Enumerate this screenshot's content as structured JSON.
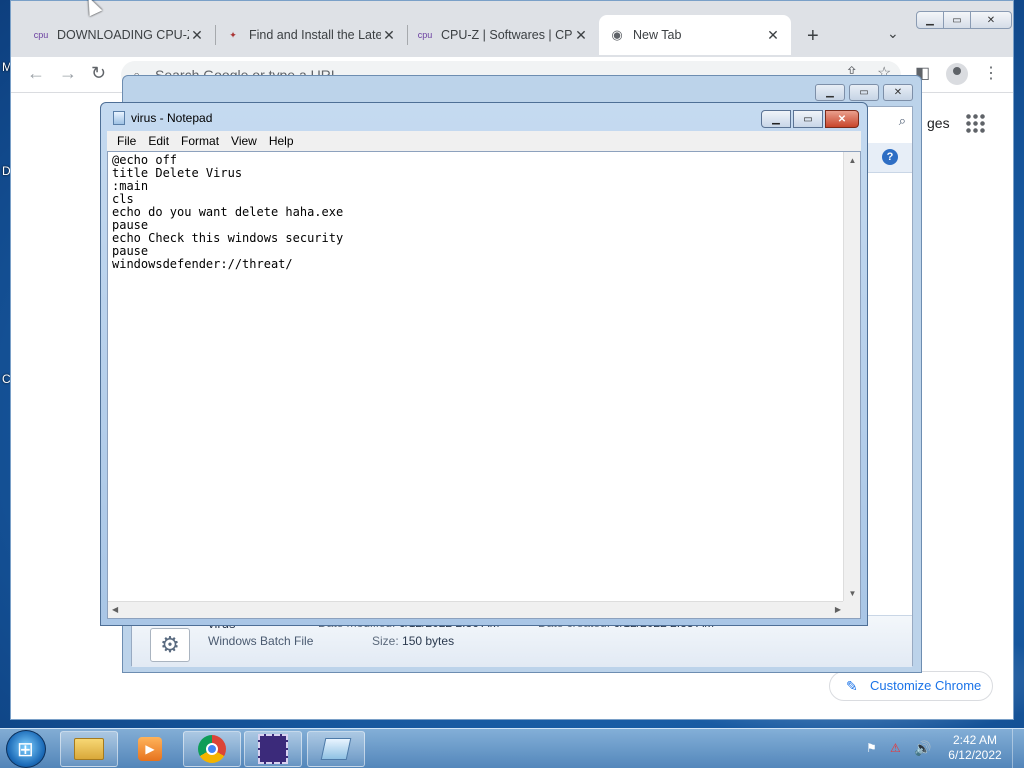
{
  "desktop": {
    "edge_letters": [
      "M",
      "D",
      "C"
    ]
  },
  "chrome": {
    "tabs": [
      {
        "title": "DOWNLOADING CPU-Z",
        "favicon": "cpuz-icon"
      },
      {
        "title": "Find and Install the Late",
        "favicon": "driver-icon"
      },
      {
        "title": "CPU-Z | Softwares | CPU",
        "favicon": "cpuz-icon"
      },
      {
        "title": "New Tab",
        "favicon": "chrome-icon",
        "active": true
      }
    ],
    "omnibox_placeholder": "Search Google or type a URL",
    "images_link": "ges",
    "customize_label": "Customize Chrome"
  },
  "notepad": {
    "title": "virus - Notepad",
    "menu": [
      "File",
      "Edit",
      "Format",
      "View",
      "Help"
    ],
    "content": "@echo off\ntitle Delete Virus\n:main\ncls\necho do you want delete haha.exe\npause\necho Check this windows security\npause\nwindowsdefender://threat/"
  },
  "details": {
    "name": "virus",
    "type": "Windows Batch File",
    "date_modified_label": "Date modified:",
    "date_modified": "6/12/2022 2:36 AM",
    "date_created_label": "Date created:",
    "date_created": "6/12/2022 2:33 AM",
    "size_label": "Size:",
    "size": "150 bytes"
  },
  "taskbar": {
    "items": [
      "explorer-icon",
      "media-player-icon",
      "chrome-icon",
      "cpuz-icon",
      "notepad-icon"
    ],
    "time": "2:42 AM",
    "date": "6/12/2022"
  }
}
